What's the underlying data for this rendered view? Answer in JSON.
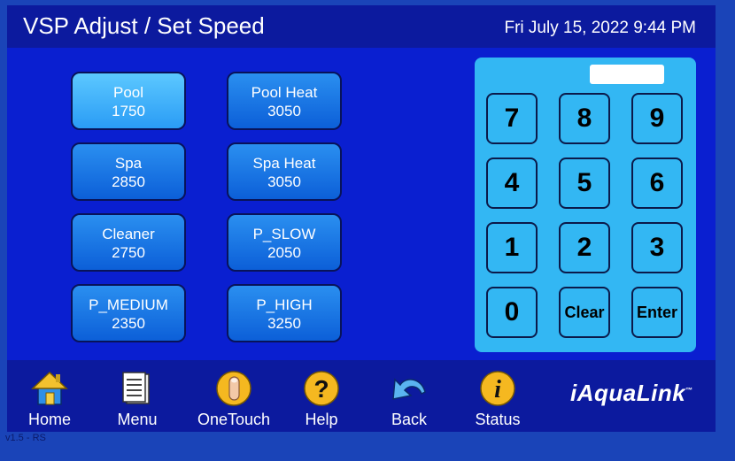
{
  "header": {
    "title": "VSP Adjust / Set Speed",
    "datetime": "Fri July 15, 2022 9:44 PM"
  },
  "presets": [
    {
      "name": "Pool",
      "speed": "1750",
      "active": true
    },
    {
      "name": "Pool Heat",
      "speed": "3050"
    },
    {
      "name": "Spa",
      "speed": "2850"
    },
    {
      "name": "Spa Heat",
      "speed": "3050"
    },
    {
      "name": "Cleaner",
      "speed": "2750"
    },
    {
      "name": "P_SLOW",
      "speed": "2050"
    },
    {
      "name": "P_MEDIUM",
      "speed": "2350"
    },
    {
      "name": "P_HIGH",
      "speed": "3250"
    }
  ],
  "keypad": {
    "entry_value": "",
    "keys": [
      "7",
      "8",
      "9",
      "4",
      "5",
      "6",
      "1",
      "2",
      "3",
      "0",
      "Clear",
      "Enter"
    ]
  },
  "nav": [
    {
      "label": "Home",
      "icon": "house-icon"
    },
    {
      "label": "Menu",
      "icon": "menu-page-icon"
    },
    {
      "label": "OneTouch",
      "icon": "finger-touch-icon"
    },
    {
      "label": "Help",
      "icon": "question-icon"
    },
    {
      "label": "Back",
      "icon": "back-arrow-icon"
    },
    {
      "label": "Status",
      "icon": "info-icon"
    }
  ],
  "brand": {
    "name": "iAquaLink",
    "mark": "™"
  },
  "version": "v1.5 - RS",
  "colors": {
    "background": "#0a1fd0",
    "bars": "#0c1a9e",
    "keypad": "#33b7f3",
    "preset": "#1a7ae8",
    "preset_active": "#44b8fa"
  }
}
